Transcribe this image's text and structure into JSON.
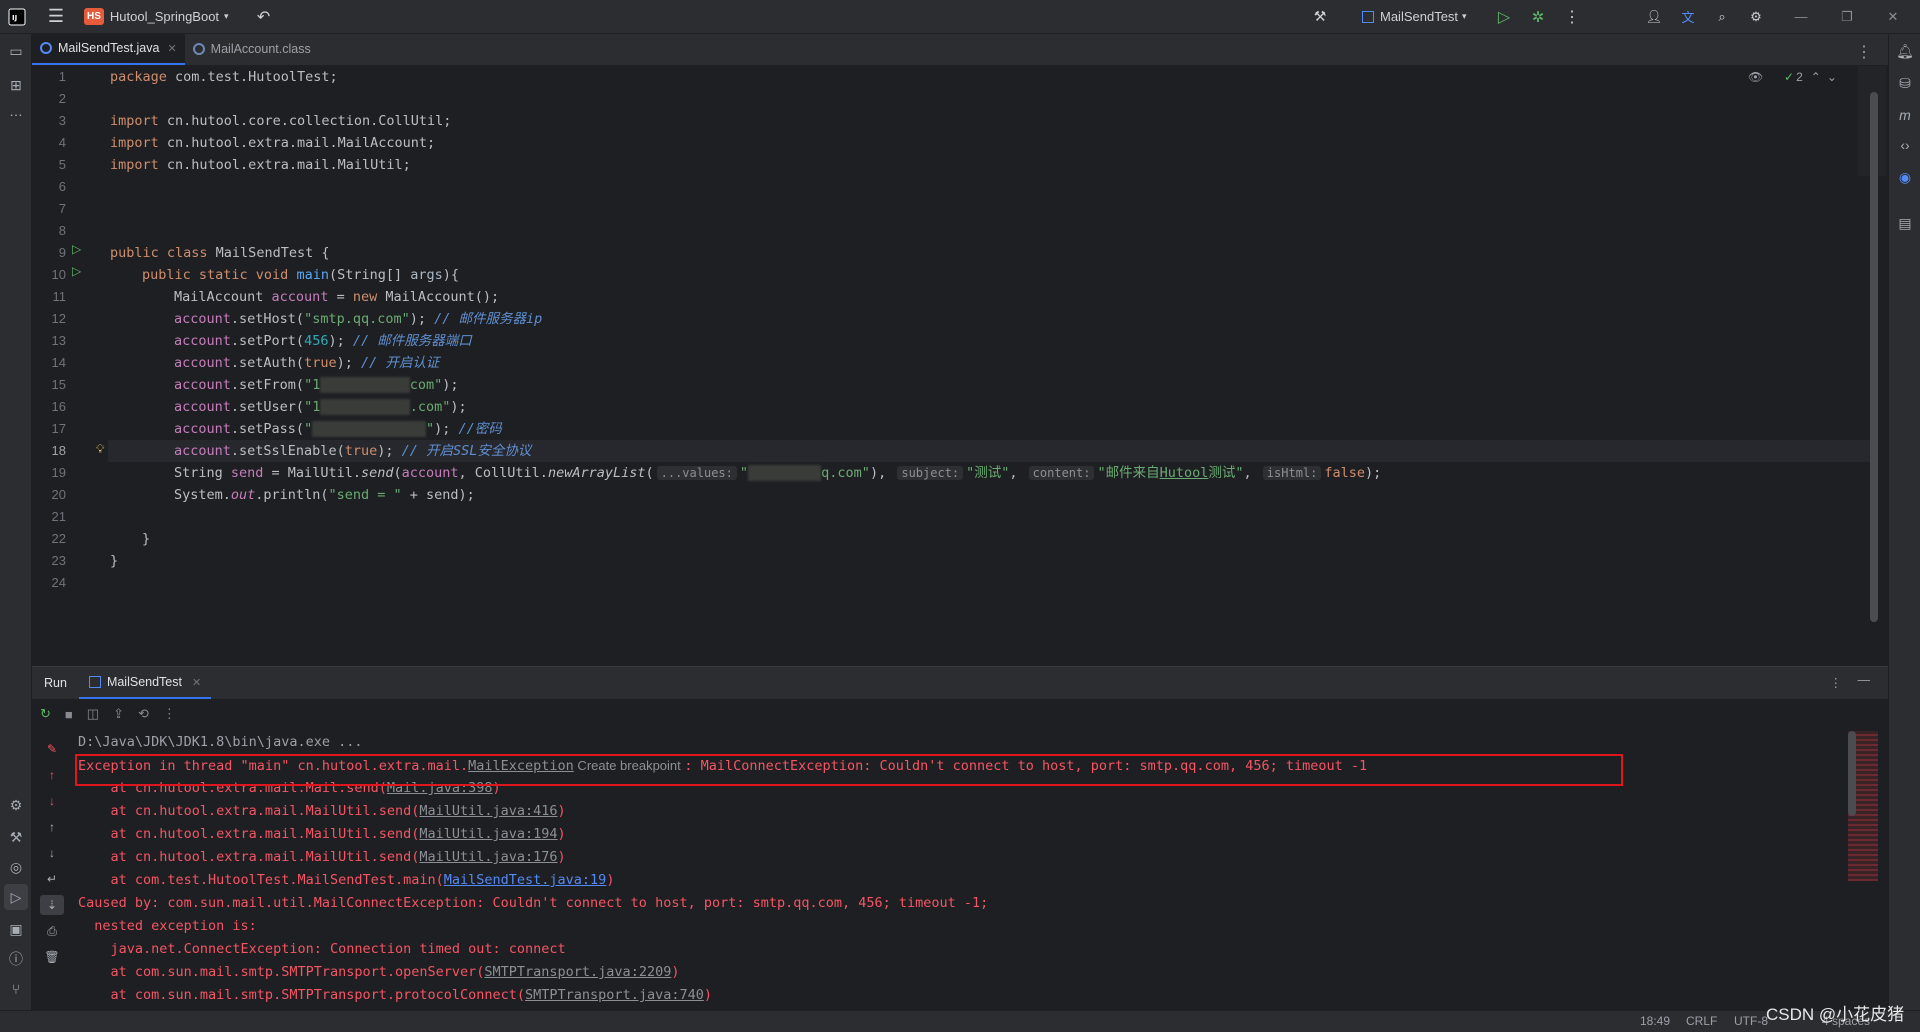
{
  "titlebar": {
    "project_badge": "HS",
    "project_name": "Hutool_SpringBoot",
    "run_config": "MailSendTest"
  },
  "tabs": [
    {
      "label": "MailSendTest.java"
    },
    {
      "label": "MailAccount.class"
    }
  ],
  "editor": {
    "inspection_count": "2",
    "line_numbers": [
      "1",
      "2",
      "3",
      "4",
      "5",
      "6",
      "7",
      "8",
      "9",
      "10",
      "11",
      "12",
      "13",
      "14",
      "15",
      "16",
      "17",
      "18",
      "19",
      "20",
      "21",
      "22",
      "23",
      "24"
    ]
  },
  "code": {
    "l1_kw": "package",
    "l1_rest": " com.test.HutoolTest;",
    "l3_kw": "import",
    "l3_rest": " cn.hutool.core.collection.CollUtil;",
    "l4_kw": "import",
    "l4_rest": " cn.hutool.extra.mail.MailAccount;",
    "l5_kw": "import",
    "l5_rest": " cn.hutool.extra.mail.MailUtil;",
    "l9_kw": "public class",
    "l9_name": " MailSendTest {",
    "l10_kw": "public static void",
    "l10_meth": " main",
    "l10_rest": "(String[] ",
    "l10_param": "args",
    "l10_end": "){",
    "l11_type": "MailAccount ",
    "l11_var": "account",
    "l11_eq": " = ",
    "l11_new": "new",
    "l11_rest": " MailAccount();",
    "account": "account",
    "l12_call": ".setHost(",
    "l12_str": "\"smtp.qq.com\"",
    "l12_end": "); ",
    "l12_cmt": "// 邮件服务器ip",
    "l13_call": ".setPort(",
    "l13_num": "456",
    "l13_end": "); ",
    "l13_cmt": "// 邮件服务器端口",
    "l14_call": ".setAuth(",
    "l14_kw": "true",
    "l14_end": "); ",
    "l14_cmt": "// 开启认证",
    "l15_call": ".setFrom(",
    "l15_str_a": "\"1",
    "l15_str_b": "com\"",
    "l15_end": ");",
    "l16_call": ".setUser(",
    "l16_str_a": "\"1",
    "l16_str_b": ".com\"",
    "l16_end": ");",
    "l17_call": ".setPass(",
    "l17_str_a": "\"",
    "l17_str_b": "\"",
    "l17_end": "); ",
    "l17_cmt": "//密码",
    "l18_call": ".setSslEnable(",
    "l18_kw": "true",
    "l18_end": "); ",
    "l18_cmt": "// 开启SSL安全协议",
    "l19_type": "String ",
    "l19_var": "send",
    "l19_eq": " = MailUtil.",
    "l19_meth": "send",
    "l19_open": "(",
    "l19_acc": "account",
    "l19_mid": ", CollUtil.",
    "l19_meth2": "newArrayList",
    "l19_p": "(",
    "l19_hint1": "...values:",
    "l19_s1a": "\"",
    "l19_s1b": "q.com\"",
    "l19_c1": "), ",
    "l19_hint2": "subject:",
    "l19_s2": "\"测试\"",
    "l19_c2": ", ",
    "l19_hint3": "content:",
    "l19_s3a": "\"邮件来自",
    "l19_s3link": "Hutool",
    "l19_s3b": "测试\"",
    "l19_c3": ", ",
    "l19_hint4": "isHtml:",
    "l19_kw": "false",
    "l19_end": ");",
    "l20_a": "System.",
    "l20_out": "out",
    "l20_b": ".println(",
    "l20_str": "\"send = \"",
    "l20_c": " + send);",
    "l22": "}",
    "l23": "}"
  },
  "run": {
    "run_label": "Run",
    "tab_label": "MailSendTest"
  },
  "console": {
    "cmd": "D:\\Java\\JDK\\JDK1.8\\bin\\java.exe ...",
    "ex_a": "Exception in thread \"main\" cn.hutool.extra.mail.",
    "ex_link": "MailException",
    "ex_bp": " Create breakpoint ",
    "ex_b": ": MailConnectException: Couldn't connect to host, port: smtp.qq.com, 456; timeout -1",
    "st1_a": "    at cn.hutool.extra.mail.Mail.send(",
    "st1_l": "Mail.java:398",
    "st1_b": ")",
    "st2_a": "    at cn.hutool.extra.mail.MailUtil.send(",
    "st2_l": "MailUtil.java:416",
    "st2_b": ")",
    "st3_a": "    at cn.hutool.extra.mail.MailUtil.send(",
    "st3_l": "MailUtil.java:194",
    "st3_b": ")",
    "st4_a": "    at cn.hutool.extra.mail.MailUtil.send(",
    "st4_l": "MailUtil.java:176",
    "st4_b": ")",
    "st5_a": "    at com.test.HutoolTest.MailSendTest.main(",
    "st5_l": "MailSendTest.java:19",
    "st5_b": ")",
    "caused": "Caused by: com.sun.mail.util.MailConnectException: Couldn't connect to host, port: smtp.qq.com, 456; timeout -1;",
    "nested": "  nested exception is:",
    "conn": "    java.net.ConnectException: Connection timed out: connect",
    "st6_a": "    at com.sun.mail.smtp.SMTPTransport.openServer(",
    "st6_l": "SMTPTransport.java:2209",
    "st6_b": ")",
    "st7_a": "    at com.sun.mail.smtp.SMTPTransport.protocolConnect(",
    "st7_l": "SMTPTransport.java:740",
    "st7_b": ")"
  },
  "statusbar": {
    "position": "18:49",
    "line_sep": "CRLF",
    "encoding": "UTF-8",
    "indent": "4 spaces"
  },
  "watermark": "CSDN @小花皮猪",
  "colors": {
    "accent": "#3574f0",
    "error": "#f75464",
    "highlight_box": "#e0161e"
  }
}
